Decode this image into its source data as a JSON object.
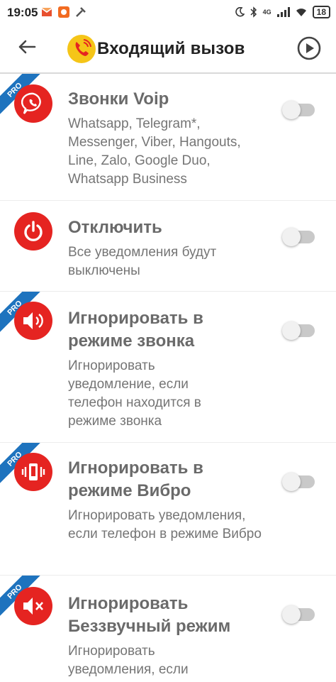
{
  "status_bar": {
    "time": "19:05",
    "network": "4G",
    "battery": "18"
  },
  "app_bar": {
    "title": "Входящий вызов"
  },
  "pro_label": "PRO",
  "items": [
    {
      "title": "Звонки Voip",
      "description": "Whatsapp, Telegram*, Messenger, Viber, Hangouts, Line, Zalo, Google Duo, Whatsapp Business",
      "pro": true,
      "enabled": false
    },
    {
      "title": "Отключить",
      "description": "Все уведомления будут выключены",
      "pro": false,
      "enabled": false
    },
    {
      "title": "Игнорировать в режиме звонка",
      "description": "Игнорировать уведомление, если телефон находится в режиме звонка",
      "pro": true,
      "enabled": false
    },
    {
      "title": "Игнорировать в режиме Вибро",
      "description": "Игнорировать уведомления, если телефон в режиме Вибро",
      "pro": true,
      "enabled": false
    },
    {
      "title": "Игнорировать Беззвучный режим",
      "description": "Игнорировать уведомления, если",
      "pro": true,
      "enabled": false
    }
  ],
  "colors": {
    "accent_red": "#e52421",
    "pro_blue": "#1e73be",
    "logo_yellow": "#f5c518"
  }
}
